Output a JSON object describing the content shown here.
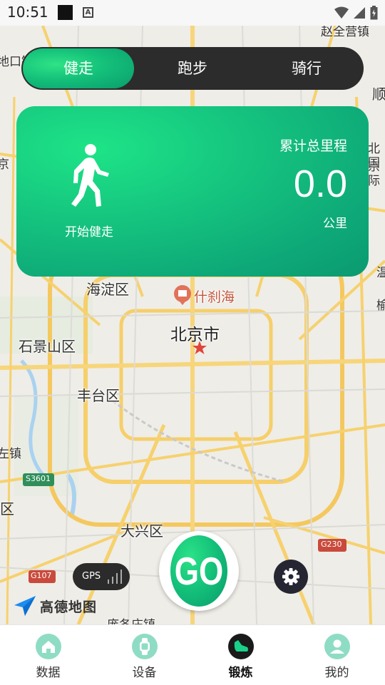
{
  "status_bar": {
    "time": "10:51",
    "a_icon": "A"
  },
  "tabs": [
    {
      "label": "健走",
      "active": true
    },
    {
      "label": "跑步",
      "active": false
    },
    {
      "label": "骑行",
      "active": false
    }
  ],
  "card": {
    "start_label": "开始健走",
    "total_label": "累计总里程",
    "total_value": "0.0",
    "unit": "公里"
  },
  "map": {
    "labels": {
      "haidian": "海淀区",
      "shichahai": "什刹海",
      "beijing": "北京市",
      "shijingshan": "石景山区",
      "fengtai": "丰台区",
      "daxing": "大兴区",
      "road_s3601": "S3601",
      "road_g107": "G107",
      "road_g230": "G230",
      "top_right": "赵全营镇",
      "top_left": "地口镇",
      "edge_shun": "顺",
      "edge_beijing_intl": "北京",
      "edge_guoji": "国际",
      "edge_jing": "京",
      "edge_wen": "温",
      "edge_yu": "榆",
      "edge_zhen": "左镇",
      "edge_qu": "区",
      "bottom_partial": "庞各庄镇"
    },
    "brand": "高德地图"
  },
  "gps": {
    "label": "GPS"
  },
  "go": {
    "label": "GO"
  },
  "bottom_nav": [
    {
      "label": "数据",
      "icon": "home-icon",
      "active": false
    },
    {
      "label": "设备",
      "icon": "watch-icon",
      "active": false
    },
    {
      "label": "锻炼",
      "icon": "shoe-icon",
      "active": true
    },
    {
      "label": "我的",
      "icon": "user-icon",
      "active": false
    }
  ],
  "colors": {
    "accent": "#14c07a",
    "dark": "#2c2c2c",
    "nav_icon": "#8fdcc5"
  }
}
